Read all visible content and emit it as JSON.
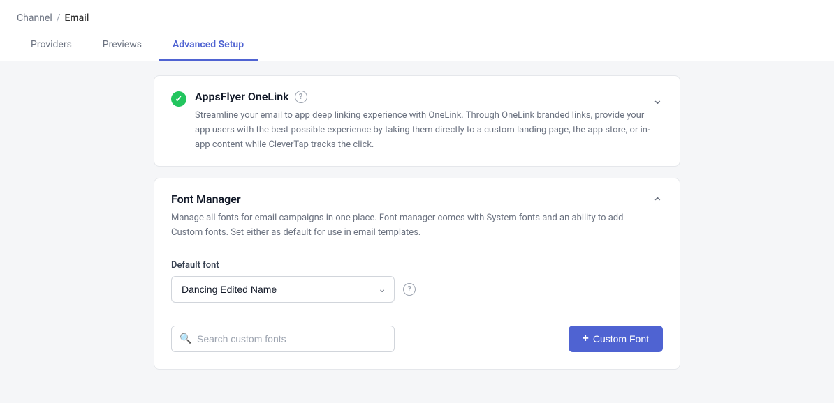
{
  "breadcrumb": {
    "channel": "Channel",
    "separator": "/",
    "email": "Email"
  },
  "tabs": [
    {
      "id": "providers",
      "label": "Providers",
      "active": false
    },
    {
      "id": "previews",
      "label": "Previews",
      "active": false
    },
    {
      "id": "advanced-setup",
      "label": "Advanced Setup",
      "active": true
    }
  ],
  "sections": {
    "appsflyer": {
      "title": "AppsFlyer OneLink",
      "description": "Streamline your email to app deep linking experience with OneLink. Through OneLink branded links, provide your app users with the best possible experience by taking them directly to a custom landing page, the app store, or in-app content while CleverTap tracks the click.",
      "collapsed": true
    },
    "fontManager": {
      "title": "Font Manager",
      "description": "Manage all fonts for email campaigns in one place. Font manager comes with System fonts and an ability to add Custom fonts. Set either as default for use in email templates.",
      "collapsed": false,
      "defaultFontLabel": "Default font",
      "selectedFont": "Dancing Edited Name",
      "searchPlaceholder": "Search custom fonts",
      "addButtonLabel": "Custom Font"
    }
  }
}
